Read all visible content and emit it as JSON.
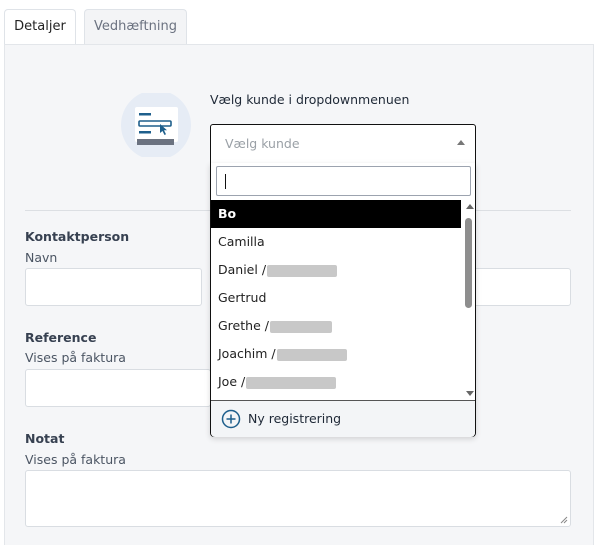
{
  "tabs": [
    {
      "label": "Detaljer",
      "active": true
    },
    {
      "label": "Vedhæftning",
      "active": false
    }
  ],
  "customer_select": {
    "prompt": "Vælg kunde i dropdownmenuen",
    "placeholder": "Vælg kunde",
    "search_value": "",
    "options": [
      {
        "label": "Bo",
        "highlighted": true
      },
      {
        "label": "Camilla"
      },
      {
        "label": "Daniel /"
      },
      {
        "label": "Gertrud"
      },
      {
        "label": "Grethe /"
      },
      {
        "label": "Joachim /"
      },
      {
        "label": "Joe /"
      }
    ],
    "new_registration_label": "Ny registrering"
  },
  "contact": {
    "heading": "Kontaktperson",
    "name_label": "Navn",
    "name_value": "",
    "second_value": ""
  },
  "reference": {
    "heading": "Reference",
    "hint": "Vises på faktura",
    "value": ""
  },
  "note": {
    "heading": "Notat",
    "hint": "Vises på faktura",
    "value": ""
  },
  "colors": {
    "accent": "#1e5f8c",
    "highlight": "#000000",
    "panel_bg": "#f5f6f8"
  },
  "icons": {
    "illustration": "customer-form-illustration",
    "add": "plus-circle-icon",
    "dropdown": "chevron-up-icon"
  }
}
